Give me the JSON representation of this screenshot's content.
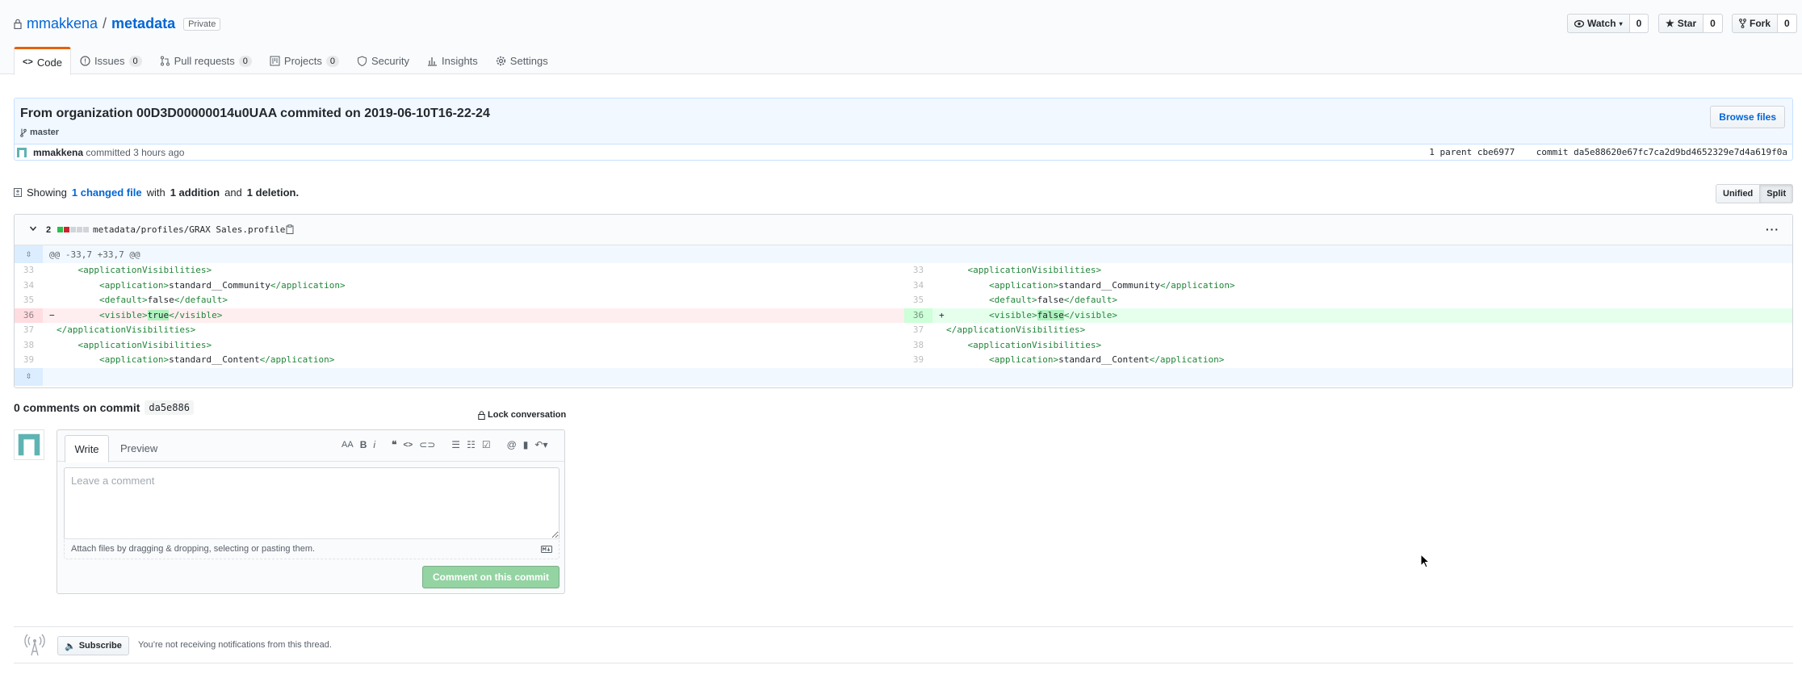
{
  "repo": {
    "owner": "mmakkena",
    "separator": "/",
    "name": "metadata",
    "visibility": "Private"
  },
  "actions": {
    "watch_label": "Watch",
    "watch_count": "0",
    "star_label": "Star",
    "star_count": "0",
    "fork_label": "Fork",
    "fork_count": "0"
  },
  "tabs": [
    {
      "label": "Code",
      "icon": "code-icon",
      "selected": true
    },
    {
      "label": "Issues",
      "count": "0",
      "icon": "issue-icon"
    },
    {
      "label": "Pull requests",
      "count": "0",
      "icon": "pull-request-icon"
    },
    {
      "label": "Projects",
      "count": "0",
      "icon": "project-icon"
    },
    {
      "label": "Security",
      "icon": "shield-icon"
    },
    {
      "label": "Insights",
      "icon": "graph-icon"
    },
    {
      "label": "Settings",
      "icon": "gear-icon"
    }
  ],
  "commit": {
    "title": "From organization 00D3D00000014u0UAA commited on 2019-06-10T16-22-24",
    "branch": "master",
    "browse_label": "Browse files",
    "author": "mmakkena",
    "when": "committed 3 hours ago",
    "parent_text": "1 parent",
    "parent_sha": "cbe6977",
    "commit_text": "commit",
    "commit_sha": "da5e88620e67fc7ca2d9bd4652329e7d4a619f0a"
  },
  "toc": {
    "prefix": "Showing",
    "changed": "1 changed file",
    "mid": "with",
    "additions": "1 addition",
    "and": "and",
    "deletions": "1 deletion."
  },
  "view_toggle": {
    "unified": "Unified",
    "split": "Split"
  },
  "file": {
    "changes": "2",
    "path": "metadata/profiles/GRAX Sales.profile",
    "hunk": "@@ -33,7 +33,7 @@"
  },
  "diff_rows": [
    {
      "ln": "33",
      "rn": "33",
      "l_code": "    <applicationVisibilities>",
      "r_code": "    <applicationVisibilities>"
    },
    {
      "ln": "34",
      "rn": "34",
      "l_code": "        <application>standard__Community</application>",
      "r_code": "        <application>standard__Community</application>"
    },
    {
      "ln": "35",
      "rn": "35",
      "l_code": "        <default>false</default>",
      "r_code": "        <default>false</default>"
    },
    {
      "ln": "36",
      "rn": "36",
      "l_sign": "−",
      "r_sign": "+",
      "l_pre": "        <visible>",
      "l_hl": "true",
      "l_post": "</visible>",
      "r_pre": "        <visible>",
      "r_hl": "false",
      "r_post": "</visible>",
      "changed": true
    },
    {
      "ln": "37",
      "rn": "37",
      "l_code": "</applicationVisibilities>",
      "r_code": "</applicationVisibilities>"
    },
    {
      "ln": "38",
      "rn": "38",
      "l_code": "    <applicationVisibilities>",
      "r_code": "    <applicationVisibilities>"
    },
    {
      "ln": "39",
      "rn": "39",
      "l_code": "        <application>standard__Content</application>",
      "r_code": "        <application>standard__Content</application>"
    }
  ],
  "comments": {
    "count_text": "0 comments on commit",
    "sha": "da5e886",
    "lock_label": "Lock conversation",
    "write_tab": "Write",
    "preview_tab": "Preview",
    "placeholder": "Leave a comment",
    "attach_text": "Attach files by dragging & dropping, selecting or pasting them.",
    "submit_label": "Comment on this commit"
  },
  "notifications": {
    "subscribe_label": "Subscribe",
    "message": "You’re not receiving notifications from this thread."
  },
  "colors": {
    "accent": "#0366d6",
    "tab_underline": "#e36209",
    "deletion_bg": "#ffeef0",
    "addition_bg": "#e6ffed",
    "submit_disabled": "#94d3a2"
  }
}
